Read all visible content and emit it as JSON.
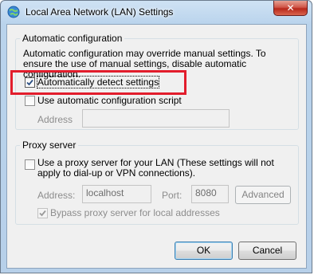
{
  "window": {
    "title": "Local Area Network (LAN) Settings",
    "close_glyph": "✕"
  },
  "auto_config": {
    "group_label": "Automatic configuration",
    "description": "Automatic configuration may override manual settings.  To ensure the use of manual settings, disable automatic configuration.",
    "detect_settings": {
      "label": "Automatically detect settings",
      "checked": true
    },
    "use_script": {
      "label": "Use automatic configuration script",
      "checked": false
    },
    "address_label": "Address",
    "address_value": ""
  },
  "proxy": {
    "group_label": "Proxy server",
    "use_proxy": {
      "label": "Use a proxy server for your LAN (These settings will not apply to dial-up or VPN connections).",
      "checked": false
    },
    "address_label": "Address:",
    "address_value": "localhost",
    "port_label": "Port:",
    "port_value": "8080",
    "advanced_label": "Advanced",
    "bypass": {
      "label": "Bypass proxy server for local addresses",
      "checked": true
    }
  },
  "buttons": {
    "ok_label": "OK",
    "cancel_label": "Cancel"
  },
  "colors": {
    "highlight_border": "#e21d2c",
    "title_gradient": "#b9d3ec"
  }
}
